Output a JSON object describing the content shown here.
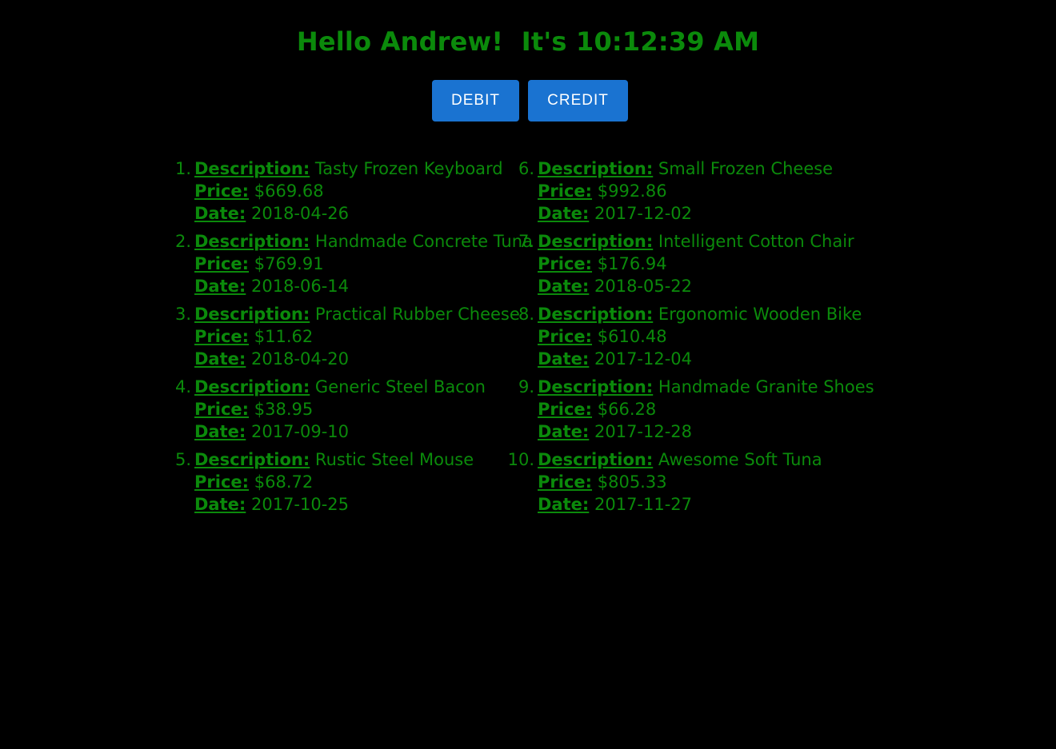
{
  "greeting": "Hello Andrew!  It's 10:12:39 AM",
  "buttons": {
    "debit": "DEBIT",
    "credit": "CREDIT"
  },
  "labels": {
    "description": "Description:",
    "price": "Price:",
    "date": "Date:"
  },
  "transactions": [
    {
      "num": "1.",
      "description": "Tasty Frozen Keyboard",
      "price": "$669.68",
      "date": "2018-04-26"
    },
    {
      "num": "2.",
      "description": "Handmade Concrete Tuna",
      "price": "$769.91",
      "date": "2018-06-14"
    },
    {
      "num": "3.",
      "description": "Practical Rubber Cheese",
      "price": "$11.62",
      "date": "2018-04-20"
    },
    {
      "num": "4.",
      "description": "Generic Steel Bacon",
      "price": "$38.95",
      "date": "2017-09-10"
    },
    {
      "num": "5.",
      "description": "Rustic Steel Mouse",
      "price": "$68.72",
      "date": "2017-10-25"
    },
    {
      "num": "6.",
      "description": "Small Frozen Cheese",
      "price": "$992.86",
      "date": "2017-12-02"
    },
    {
      "num": "7.",
      "description": "Intelligent Cotton Chair",
      "price": "$176.94",
      "date": "2018-05-22"
    },
    {
      "num": "8.",
      "description": "Ergonomic Wooden Bike",
      "price": "$610.48",
      "date": "2017-12-04"
    },
    {
      "num": "9.",
      "description": "Handmade Granite Shoes",
      "price": "$66.28",
      "date": "2017-12-28"
    },
    {
      "num": "10.",
      "description": "Awesome Soft Tuna",
      "price": "$805.33",
      "date": "2017-11-27"
    }
  ],
  "colors": {
    "background": "#000000",
    "text": "#0b8a0b",
    "button": "#1a73d1",
    "button_text": "#ffffff"
  }
}
